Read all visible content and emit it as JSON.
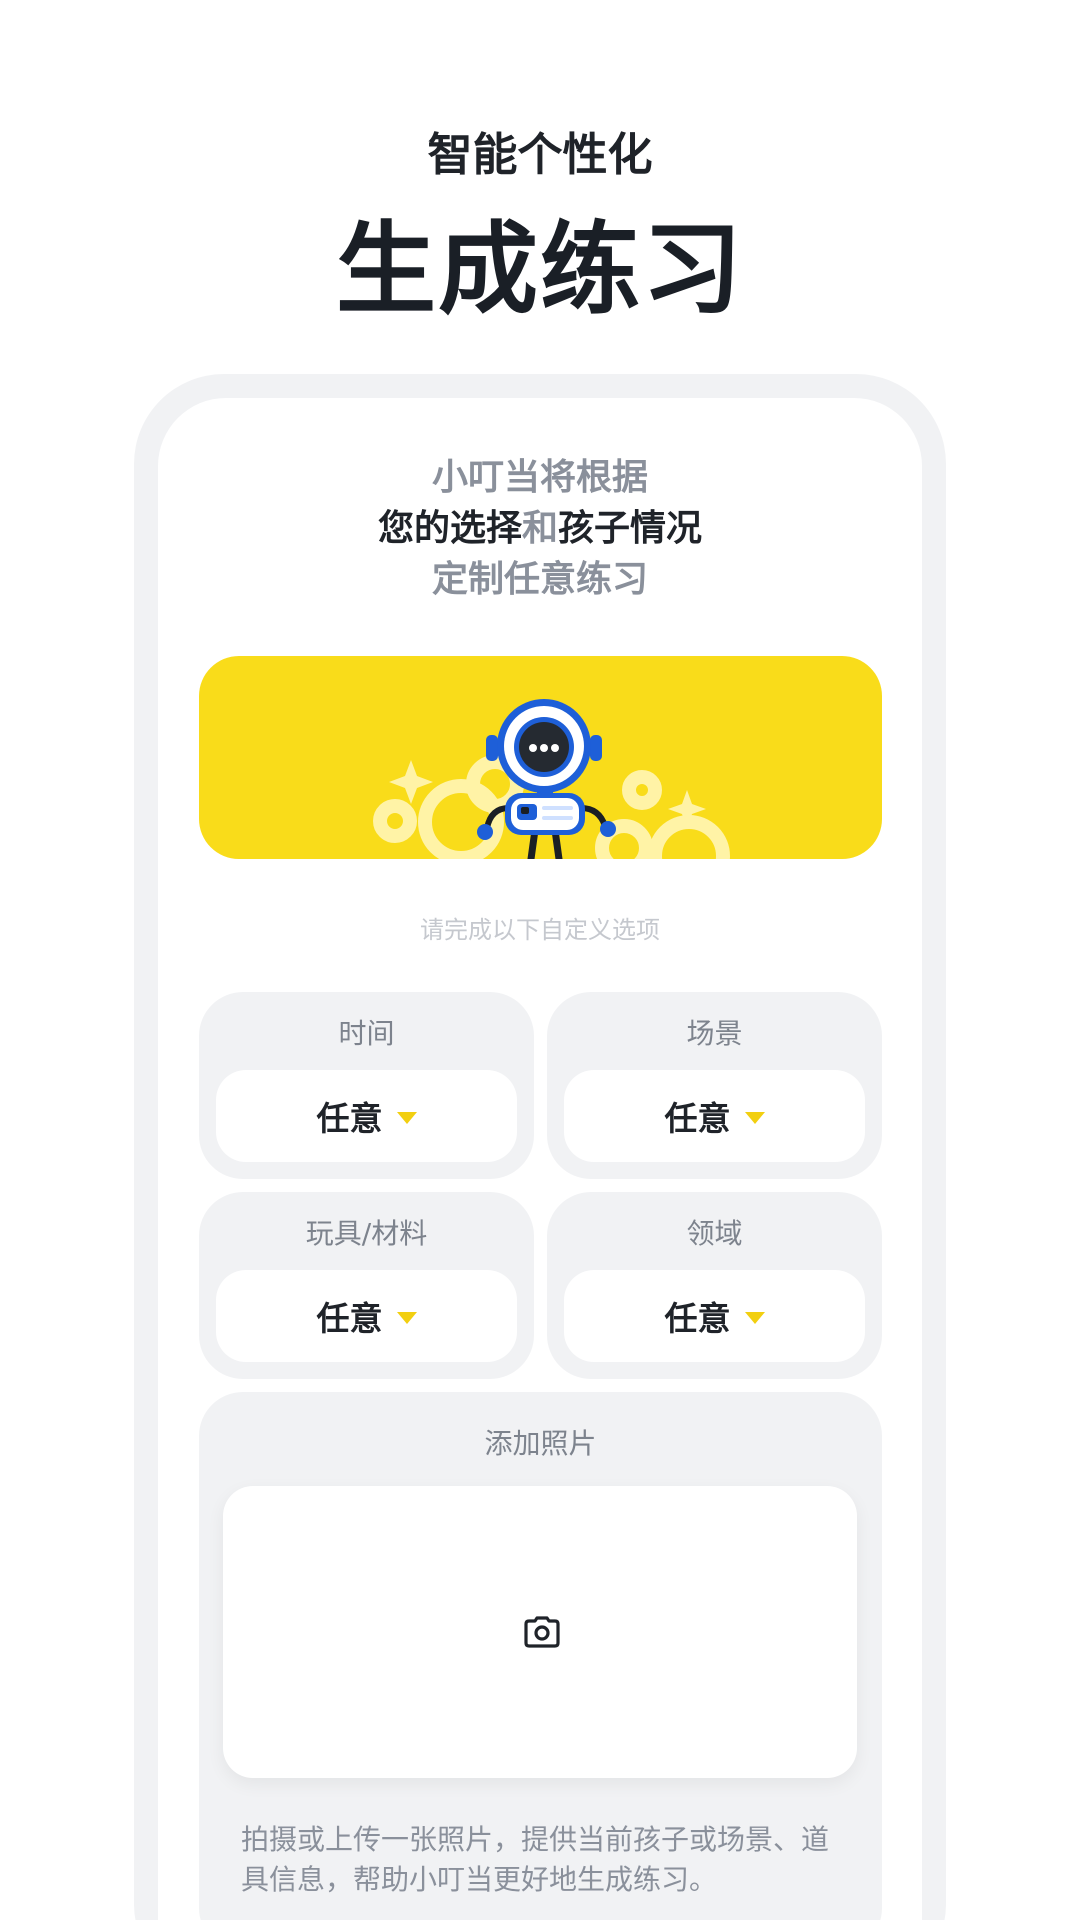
{
  "hero": {
    "subtitle": "智能个性化",
    "title": "生成练习"
  },
  "intro": {
    "line1": "小叮当将根据",
    "line2_part1": "您的选择",
    "line2_part2": "和",
    "line2_part3": "孩子情况",
    "line3": "定制任意练习"
  },
  "banner": {
    "illustration": "robot-mascot-illustration",
    "background_color": "#f9dc1a"
  },
  "hint": "请完成以下自定义选项",
  "options": [
    {
      "label": "时间",
      "value": "任意"
    },
    {
      "label": "场景",
      "value": "任意"
    },
    {
      "label": "玩具/材料",
      "value": "任意"
    },
    {
      "label": "领域",
      "value": "任意"
    }
  ],
  "photo": {
    "title": "添加照片",
    "icon": "camera-icon",
    "description": "拍摄或上传一张照片，提供当前孩子或场景、道具信息，帮助小叮当更好地生成练习。"
  },
  "colors": {
    "accent": "#f9dc1a",
    "caret": "#f2cf10",
    "card_bg": "#f1f2f4",
    "robot_blue": "#1e5fd8"
  }
}
